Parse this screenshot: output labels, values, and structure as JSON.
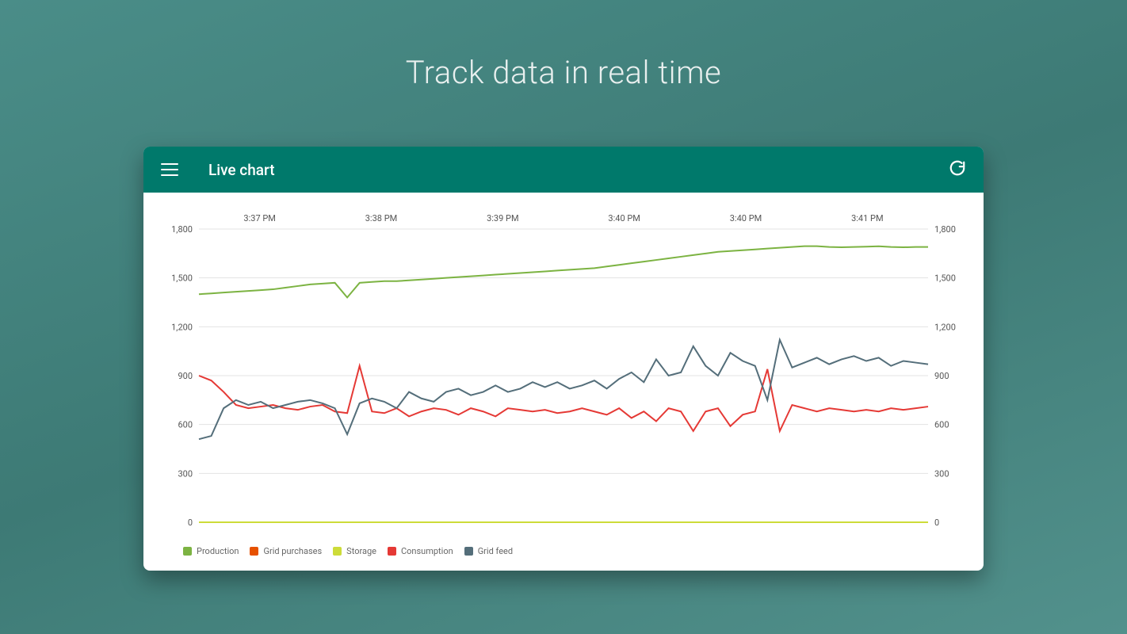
{
  "headline": "Track data in real time",
  "appbar": {
    "title": "Live chart"
  },
  "legend": [
    {
      "name": "Production",
      "color": "#7cb342"
    },
    {
      "name": "Grid purchases",
      "color": "#e65100"
    },
    {
      "name": "Storage",
      "color": "#cddc39"
    },
    {
      "name": "Consumption",
      "color": "#e53935"
    },
    {
      "name": "Grid feed",
      "color": "#546e7a"
    }
  ],
  "chart_data": {
    "type": "line",
    "xlabel": "",
    "ylabel": "",
    "ylim": [
      0,
      1800
    ],
    "y_ticks": [
      0,
      300,
      600,
      900,
      1200,
      1500,
      1800
    ],
    "x_tick_labels": [
      "3:37 PM",
      "3:38 PM",
      "3:39 PM",
      "3:40 PM",
      "3:40 PM",
      "3:41 PM"
    ],
    "x": [
      0,
      1,
      2,
      3,
      4,
      5,
      6,
      7,
      8,
      9,
      10,
      11,
      12,
      13,
      14,
      15,
      16,
      17,
      18,
      19,
      20,
      21,
      22,
      23,
      24,
      25,
      26,
      27,
      28,
      29,
      30,
      31,
      32,
      33,
      34,
      35,
      36,
      37,
      38,
      39,
      40,
      41,
      42,
      43,
      44,
      45,
      46,
      47,
      48,
      49,
      50,
      51,
      52,
      53,
      54,
      55,
      56,
      57,
      58,
      59
    ],
    "series": [
      {
        "name": "Production",
        "color": "#7cb342",
        "values": [
          1400,
          1405,
          1410,
          1415,
          1420,
          1425,
          1430,
          1440,
          1450,
          1460,
          1465,
          1470,
          1380,
          1470,
          1475,
          1480,
          1480,
          1485,
          1490,
          1495,
          1500,
          1505,
          1510,
          1515,
          1520,
          1525,
          1530,
          1535,
          1540,
          1545,
          1550,
          1555,
          1560,
          1570,
          1580,
          1590,
          1600,
          1610,
          1620,
          1630,
          1640,
          1650,
          1660,
          1665,
          1670,
          1675,
          1680,
          1685,
          1690,
          1695,
          1695,
          1690,
          1688,
          1690,
          1692,
          1694,
          1690,
          1688,
          1690,
          1690
        ]
      },
      {
        "name": "Storage",
        "color": "#cddc39",
        "values": [
          0,
          0,
          0,
          0,
          0,
          0,
          0,
          0,
          0,
          0,
          0,
          0,
          0,
          0,
          0,
          0,
          0,
          0,
          0,
          0,
          0,
          0,
          0,
          0,
          0,
          0,
          0,
          0,
          0,
          0,
          0,
          0,
          0,
          0,
          0,
          0,
          0,
          0,
          0,
          0,
          0,
          0,
          0,
          0,
          0,
          0,
          0,
          0,
          0,
          0,
          0,
          0,
          0,
          0,
          0,
          0,
          0,
          0,
          0,
          0
        ]
      },
      {
        "name": "Consumption",
        "color": "#e53935",
        "values": [
          900,
          870,
          800,
          720,
          700,
          710,
          720,
          700,
          690,
          710,
          720,
          680,
          670,
          960,
          680,
          670,
          700,
          650,
          680,
          700,
          690,
          660,
          700,
          680,
          650,
          700,
          690,
          680,
          690,
          670,
          680,
          700,
          680,
          660,
          700,
          640,
          680,
          620,
          700,
          680,
          560,
          680,
          700,
          590,
          660,
          680,
          940,
          560,
          720,
          700,
          680,
          700,
          690,
          680,
          690,
          680,
          700,
          690,
          700,
          710
        ]
      },
      {
        "name": "Grid feed",
        "color": "#546e7a",
        "values": [
          510,
          530,
          700,
          750,
          720,
          740,
          700,
          720,
          740,
          750,
          730,
          700,
          540,
          730,
          760,
          740,
          700,
          800,
          760,
          740,
          800,
          820,
          780,
          800,
          840,
          800,
          820,
          860,
          830,
          860,
          820,
          840,
          870,
          820,
          880,
          920,
          860,
          1000,
          900,
          920,
          1080,
          960,
          900,
          1040,
          990,
          960,
          750,
          1120,
          950,
          980,
          1010,
          970,
          1000,
          1020,
          990,
          1010,
          960,
          990,
          980,
          970
        ]
      }
    ]
  }
}
